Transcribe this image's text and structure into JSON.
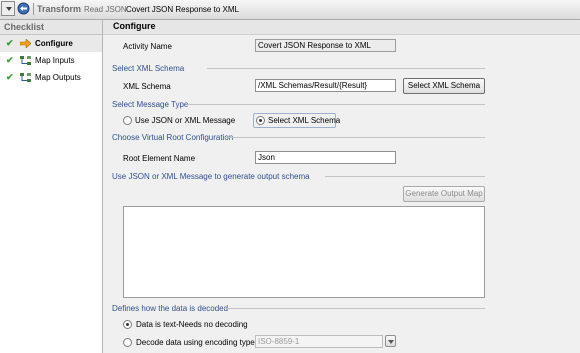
{
  "titlebar": {
    "title": "Transform",
    "subtitle": "Read JSON",
    "activity_name": "Covert JSON Response to XML"
  },
  "checklist": {
    "header": "Checklist",
    "items": [
      {
        "label": "Configure",
        "active": true,
        "icon": "arrow-right-icon"
      },
      {
        "label": "Map Inputs",
        "active": false,
        "icon": "map-icon"
      },
      {
        "label": "Map Outputs",
        "active": false,
        "icon": "map-icon"
      }
    ]
  },
  "main": {
    "title": "Configure",
    "activity_name": {
      "label": "Activity Name",
      "value": "Covert JSON Response to XML"
    },
    "xml_schema_section": {
      "title": "Select XML Schema",
      "label": "XML Schema",
      "value": "/XML Schemas/Result/{Result}",
      "button": "Select XML Schema"
    },
    "message_type_section": {
      "title": "Select Message Type",
      "options": [
        "Use JSON or XML Message",
        "Select XML Schema"
      ],
      "selected": "Select XML Schema"
    },
    "virtual_root_section": {
      "title": "Choose Virtual Root Configuration",
      "label": "Root Element Name",
      "value": "Json"
    },
    "output_schema_section": {
      "title": "Use JSON or XML Message to generate output schema",
      "button": "Generate Output Map",
      "message": ""
    },
    "decode_section": {
      "title": "Defines how the data is decoded",
      "options": [
        "Data is text-Needs no decoding",
        "Decode data using encoding type:"
      ],
      "selected": "Data is text-Needs no decoding",
      "encoding": "ISO-8859-1"
    }
  },
  "colors": {
    "section_text": "#2f4f8f",
    "check": "#3b9a3b",
    "panel_bg": "#f0f0f0"
  }
}
